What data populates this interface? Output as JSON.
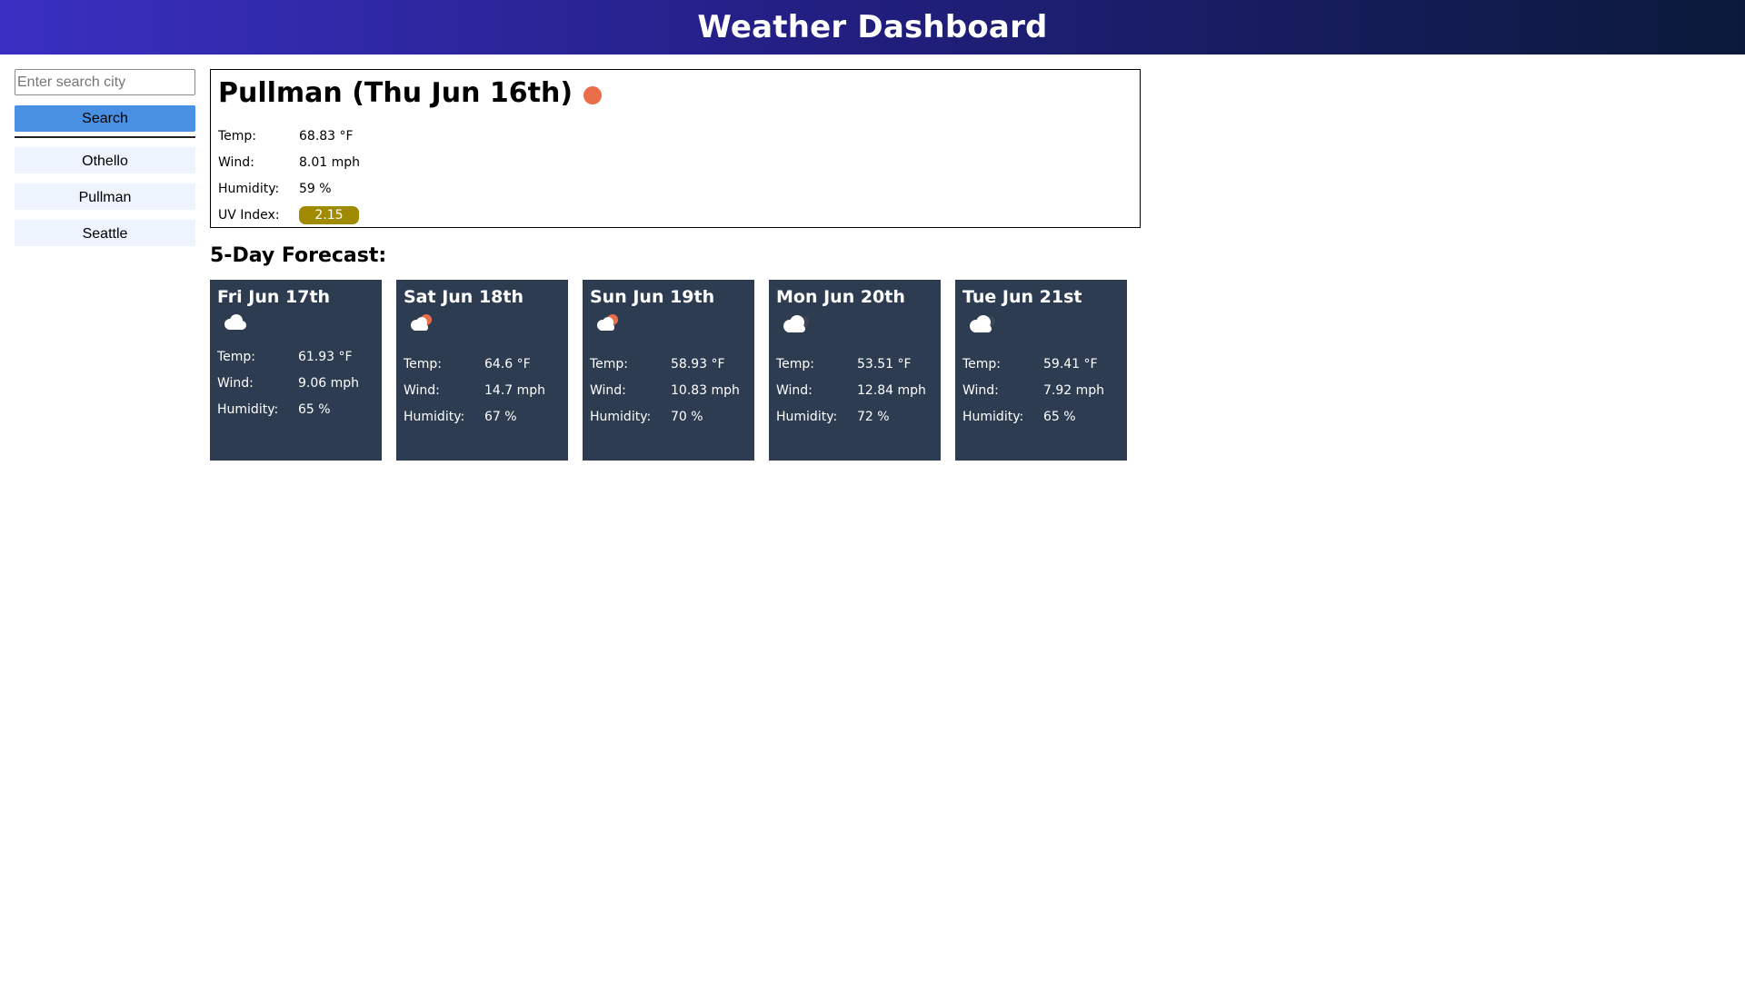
{
  "header": {
    "title": "Weather Dashboard"
  },
  "search": {
    "placeholder": "Enter search city",
    "value": "",
    "button_label": "Search"
  },
  "history": [
    {
      "label": "Othello"
    },
    {
      "label": "Pullman"
    },
    {
      "label": "Seattle"
    }
  ],
  "current": {
    "title": "Pullman (Thu Jun 16th)",
    "icon": "sun-icon",
    "stats": {
      "temp_label": "Temp:",
      "temp_value": "68.83 °F",
      "wind_label": "Wind:",
      "wind_value": "8.01 mph",
      "humidity_label": "Humidity:",
      "humidity_value": "59 %",
      "uv_label": "UV Index:",
      "uv_value": "2.15"
    },
    "uv_color": "#a08a00"
  },
  "forecast": {
    "title": "5-Day Forecast:",
    "days": [
      {
        "date": "Fri Jun 17th",
        "icon": "cloud-icon",
        "temp_label": "Temp:",
        "temp": "61.93 °F",
        "wind_label": "Wind:",
        "wind": "9.06 mph",
        "humidity_label": "Humidity:",
        "humidity": "65 %"
      },
      {
        "date": "Sat Jun 18th",
        "icon": "partly-cloudy-icon",
        "temp_label": "Temp:",
        "temp": "64.6 °F",
        "wind_label": "Wind:",
        "wind": "14.7 mph",
        "humidity_label": "Humidity:",
        "humidity": "67 %"
      },
      {
        "date": "Sun Jun 19th",
        "icon": "partly-cloudy-icon",
        "temp_label": "Temp:",
        "temp": "58.93 °F",
        "wind_label": "Wind:",
        "wind": "10.83 mph",
        "humidity_label": "Humidity:",
        "humidity": "70 %"
      },
      {
        "date": "Mon Jun 20th",
        "icon": "overcast-cloud-icon",
        "temp_label": "Temp:",
        "temp": "53.51 °F",
        "wind_label": "Wind:",
        "wind": "12.84 mph",
        "humidity_label": "Humidity:",
        "humidity": "72 %"
      },
      {
        "date": "Tue Jun 21st",
        "icon": "overcast-cloud-icon",
        "temp_label": "Temp:",
        "temp": "59.41 °F",
        "wind_label": "Wind:",
        "wind": "7.92 mph",
        "humidity_label": "Humidity:",
        "humidity": "65 %"
      }
    ]
  },
  "colors": {
    "header_start": "#3a2fc2",
    "header_end": "#0b1a3a",
    "button": "#4a90e2",
    "history_bg": "#edf4fd",
    "card_bg": "#2d3c50",
    "sun": "#eb6e4b"
  }
}
